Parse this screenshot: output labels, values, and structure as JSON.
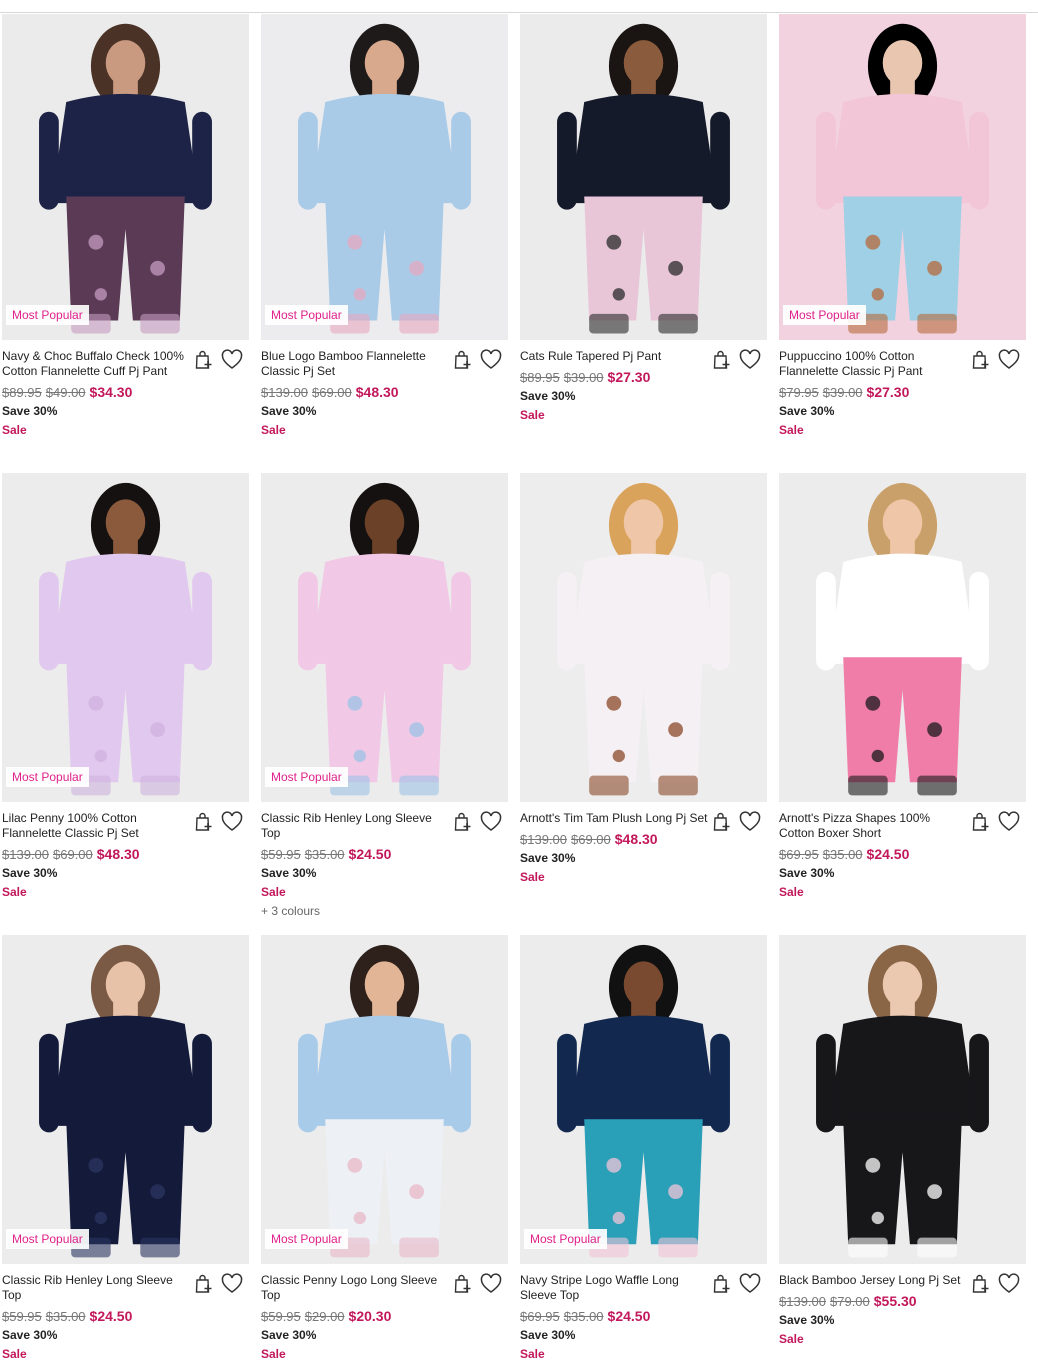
{
  "badge_label": "Most Popular",
  "colors": {
    "sale": "#c2185b",
    "badge": "#e0218a"
  },
  "products": [
    {
      "name": "Navy & Choc Buffalo Check 100% Cotton Flannelette Cuff Pj Pant",
      "was": "$89.95",
      "was2": "$49.00",
      "now": "$34.30",
      "save": "Save 30%",
      "sale": "Sale",
      "badge": true,
      "colours": ""
    },
    {
      "name": "Blue Logo Bamboo Flannelette Classic Pj Set",
      "was": "$139.00",
      "was2": "$69.00",
      "now": "$48.30",
      "save": "Save 30%",
      "sale": "Sale",
      "badge": true,
      "colours": ""
    },
    {
      "name": "Cats Rule Tapered Pj Pant",
      "was": "$89.95",
      "was2": "$39.00",
      "now": "$27.30",
      "save": "Save 30%",
      "sale": "Sale",
      "badge": false,
      "colours": ""
    },
    {
      "name": "Puppuccino 100% Cotton Flannelette Classic Pj Pant",
      "was": "$79.95",
      "was2": "$39.00",
      "now": "$27.30",
      "save": "Save 30%",
      "sale": "Sale",
      "badge": true,
      "colours": ""
    },
    {
      "name": "Lilac Penny 100% Cotton Flannelette Classic Pj Set",
      "was": "$139.00",
      "was2": "$69.00",
      "now": "$48.30",
      "save": "Save 30%",
      "sale": "Sale",
      "badge": true,
      "colours": ""
    },
    {
      "name": "Classic Rib Henley Long Sleeve Top",
      "was": "$59.95",
      "was2": "$35.00",
      "now": "$24.50",
      "save": "Save 30%",
      "sale": "Sale",
      "badge": true,
      "colours": "+ 3 colours"
    },
    {
      "name": "Arnott's Tim Tam Plush Long Pj Set",
      "was": "$139.00",
      "was2": "$69.00",
      "now": "$48.30",
      "save": "Save 30%",
      "sale": "Sale",
      "badge": false,
      "colours": ""
    },
    {
      "name": "Arnott's Pizza Shapes 100% Cotton Boxer Short",
      "was": "$69.95",
      "was2": "$35.00",
      "now": "$24.50",
      "save": "Save 30%",
      "sale": "Sale",
      "badge": false,
      "colours": ""
    },
    {
      "name": "Classic Rib Henley Long Sleeve Top",
      "was": "$59.95",
      "was2": "$35.00",
      "now": "$24.50",
      "save": "Save 30%",
      "sale": "Sale",
      "badge": true,
      "colours": ""
    },
    {
      "name": "Classic Penny Logo Long Sleeve Top",
      "was": "$59.95",
      "was2": "$29.00",
      "now": "$20.30",
      "save": "Save 30%",
      "sale": "Sale",
      "badge": true,
      "colours": ""
    },
    {
      "name": "Navy Stripe Logo Waffle Long Sleeve Top",
      "was": "$69.95",
      "was2": "$35.00",
      "now": "$24.50",
      "save": "Save 30%",
      "sale": "Sale",
      "badge": true,
      "colours": ""
    },
    {
      "name": "Black Bamboo Jersey Long Pj Set",
      "was": "$139.00",
      "was2": "$79.00",
      "now": "$55.30",
      "save": "Save 30%",
      "sale": "Sale",
      "badge": false,
      "colours": ""
    }
  ],
  "icons": {
    "bag": "add-to-bag-icon",
    "wishlist": "heart-icon"
  }
}
